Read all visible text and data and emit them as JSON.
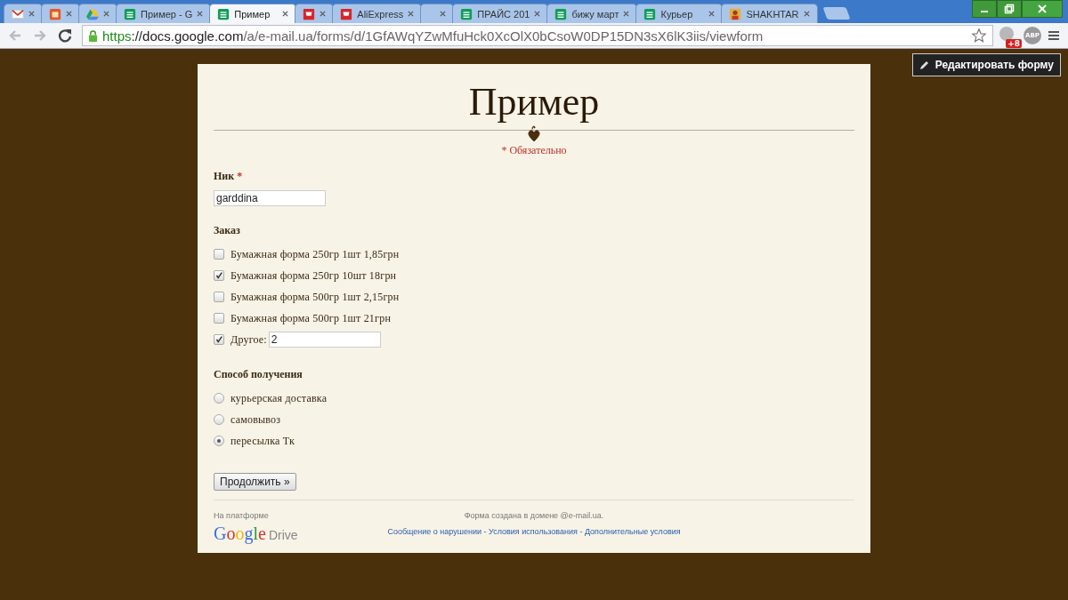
{
  "browser": {
    "tabs": [
      {
        "kind": "mail",
        "selected": false
      },
      {
        "kind": "app",
        "selected": false
      },
      {
        "kind": "drive",
        "selected": false
      },
      {
        "kind": "sheet",
        "title": "Пример - G",
        "selected": false
      },
      {
        "kind": "sheet",
        "title": "Пример",
        "selected": true
      },
      {
        "kind": "store",
        "selected": false
      },
      {
        "kind": "store",
        "title": "AliExpress",
        "selected": false
      },
      {
        "kind": "blank",
        "selected": false
      },
      {
        "kind": "sheet",
        "title": "ПРАЙС 201",
        "selected": false
      },
      {
        "kind": "sheet",
        "title": "бижу март",
        "selected": false
      },
      {
        "kind": "sheet",
        "title": "Курьер",
        "selected": false
      },
      {
        "kind": "image",
        "title": "SHAKHTAR",
        "selected": false
      }
    ],
    "url_scheme": "https",
    "url_host": "://docs.google.com",
    "url_path": "/a/e-mail.ua/forms/d/1GfAWqYZwMfuHck0XcOlX0bCsoW0DP15DN3sX6lK3iis/viewform",
    "extension_badge": "+8",
    "abp_label": "ABP"
  },
  "edit_button": "Редактировать форму",
  "form": {
    "title": "Пример",
    "required_note": "* Обязательно",
    "nick": {
      "label": "Ник",
      "required_mark": "*",
      "value": "garddina"
    },
    "order": {
      "label": "Заказ",
      "options": [
        {
          "kind": "checkbox",
          "label": "Бумажная форма 250гр 1шт 1,85грн",
          "checked": false
        },
        {
          "kind": "checkbox",
          "label": "Бумажная форма 250гр 10шт 18грн",
          "checked": true
        },
        {
          "kind": "checkbox",
          "label": "Бумажная форма 500гр 1шт 2,15грн",
          "checked": false
        },
        {
          "kind": "checkbox",
          "label": "Бумажная форма 500гр 1шт 21грн",
          "checked": false
        },
        {
          "kind": "other",
          "label": "Другое:",
          "checked": true,
          "value": "2"
        }
      ]
    },
    "delivery": {
      "label": "Способ получения",
      "options": [
        {
          "label": "курьерская доставка",
          "selected": false
        },
        {
          "label": "самовывоз",
          "selected": false
        },
        {
          "label": "пересылка Тк",
          "selected": true
        }
      ]
    },
    "continue_button": "Продолжить »",
    "footer": {
      "platform_label": "На платформе",
      "logo_word": "Google",
      "logo_product": "Drive",
      "domain_note": "Форма создана в домене @e-mail.ua.",
      "links": [
        "Сообщение о нарушении",
        "Условия использования",
        "Дополнительные условия"
      ],
      "separator": " - "
    }
  }
}
